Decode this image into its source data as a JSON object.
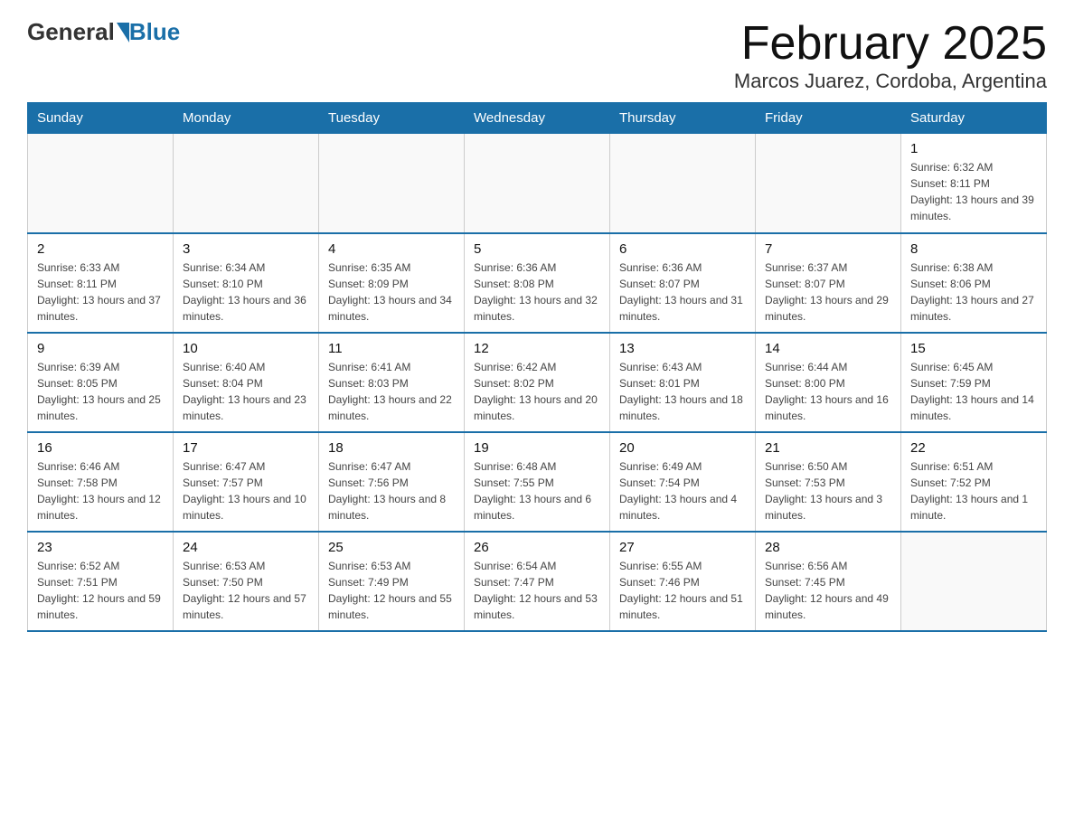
{
  "header": {
    "logo_general": "General",
    "logo_blue": "Blue",
    "month_title": "February 2025",
    "location": "Marcos Juarez, Cordoba, Argentina"
  },
  "days_of_week": [
    "Sunday",
    "Monday",
    "Tuesday",
    "Wednesday",
    "Thursday",
    "Friday",
    "Saturday"
  ],
  "weeks": [
    [
      {
        "day": "",
        "info": ""
      },
      {
        "day": "",
        "info": ""
      },
      {
        "day": "",
        "info": ""
      },
      {
        "day": "",
        "info": ""
      },
      {
        "day": "",
        "info": ""
      },
      {
        "day": "",
        "info": ""
      },
      {
        "day": "1",
        "info": "Sunrise: 6:32 AM\nSunset: 8:11 PM\nDaylight: 13 hours and 39 minutes."
      }
    ],
    [
      {
        "day": "2",
        "info": "Sunrise: 6:33 AM\nSunset: 8:11 PM\nDaylight: 13 hours and 37 minutes."
      },
      {
        "day": "3",
        "info": "Sunrise: 6:34 AM\nSunset: 8:10 PM\nDaylight: 13 hours and 36 minutes."
      },
      {
        "day": "4",
        "info": "Sunrise: 6:35 AM\nSunset: 8:09 PM\nDaylight: 13 hours and 34 minutes."
      },
      {
        "day": "5",
        "info": "Sunrise: 6:36 AM\nSunset: 8:08 PM\nDaylight: 13 hours and 32 minutes."
      },
      {
        "day": "6",
        "info": "Sunrise: 6:36 AM\nSunset: 8:07 PM\nDaylight: 13 hours and 31 minutes."
      },
      {
        "day": "7",
        "info": "Sunrise: 6:37 AM\nSunset: 8:07 PM\nDaylight: 13 hours and 29 minutes."
      },
      {
        "day": "8",
        "info": "Sunrise: 6:38 AM\nSunset: 8:06 PM\nDaylight: 13 hours and 27 minutes."
      }
    ],
    [
      {
        "day": "9",
        "info": "Sunrise: 6:39 AM\nSunset: 8:05 PM\nDaylight: 13 hours and 25 minutes."
      },
      {
        "day": "10",
        "info": "Sunrise: 6:40 AM\nSunset: 8:04 PM\nDaylight: 13 hours and 23 minutes."
      },
      {
        "day": "11",
        "info": "Sunrise: 6:41 AM\nSunset: 8:03 PM\nDaylight: 13 hours and 22 minutes."
      },
      {
        "day": "12",
        "info": "Sunrise: 6:42 AM\nSunset: 8:02 PM\nDaylight: 13 hours and 20 minutes."
      },
      {
        "day": "13",
        "info": "Sunrise: 6:43 AM\nSunset: 8:01 PM\nDaylight: 13 hours and 18 minutes."
      },
      {
        "day": "14",
        "info": "Sunrise: 6:44 AM\nSunset: 8:00 PM\nDaylight: 13 hours and 16 minutes."
      },
      {
        "day": "15",
        "info": "Sunrise: 6:45 AM\nSunset: 7:59 PM\nDaylight: 13 hours and 14 minutes."
      }
    ],
    [
      {
        "day": "16",
        "info": "Sunrise: 6:46 AM\nSunset: 7:58 PM\nDaylight: 13 hours and 12 minutes."
      },
      {
        "day": "17",
        "info": "Sunrise: 6:47 AM\nSunset: 7:57 PM\nDaylight: 13 hours and 10 minutes."
      },
      {
        "day": "18",
        "info": "Sunrise: 6:47 AM\nSunset: 7:56 PM\nDaylight: 13 hours and 8 minutes."
      },
      {
        "day": "19",
        "info": "Sunrise: 6:48 AM\nSunset: 7:55 PM\nDaylight: 13 hours and 6 minutes."
      },
      {
        "day": "20",
        "info": "Sunrise: 6:49 AM\nSunset: 7:54 PM\nDaylight: 13 hours and 4 minutes."
      },
      {
        "day": "21",
        "info": "Sunrise: 6:50 AM\nSunset: 7:53 PM\nDaylight: 13 hours and 3 minutes."
      },
      {
        "day": "22",
        "info": "Sunrise: 6:51 AM\nSunset: 7:52 PM\nDaylight: 13 hours and 1 minute."
      }
    ],
    [
      {
        "day": "23",
        "info": "Sunrise: 6:52 AM\nSunset: 7:51 PM\nDaylight: 12 hours and 59 minutes."
      },
      {
        "day": "24",
        "info": "Sunrise: 6:53 AM\nSunset: 7:50 PM\nDaylight: 12 hours and 57 minutes."
      },
      {
        "day": "25",
        "info": "Sunrise: 6:53 AM\nSunset: 7:49 PM\nDaylight: 12 hours and 55 minutes."
      },
      {
        "day": "26",
        "info": "Sunrise: 6:54 AM\nSunset: 7:47 PM\nDaylight: 12 hours and 53 minutes."
      },
      {
        "day": "27",
        "info": "Sunrise: 6:55 AM\nSunset: 7:46 PM\nDaylight: 12 hours and 51 minutes."
      },
      {
        "day": "28",
        "info": "Sunrise: 6:56 AM\nSunset: 7:45 PM\nDaylight: 12 hours and 49 minutes."
      },
      {
        "day": "",
        "info": ""
      }
    ]
  ]
}
